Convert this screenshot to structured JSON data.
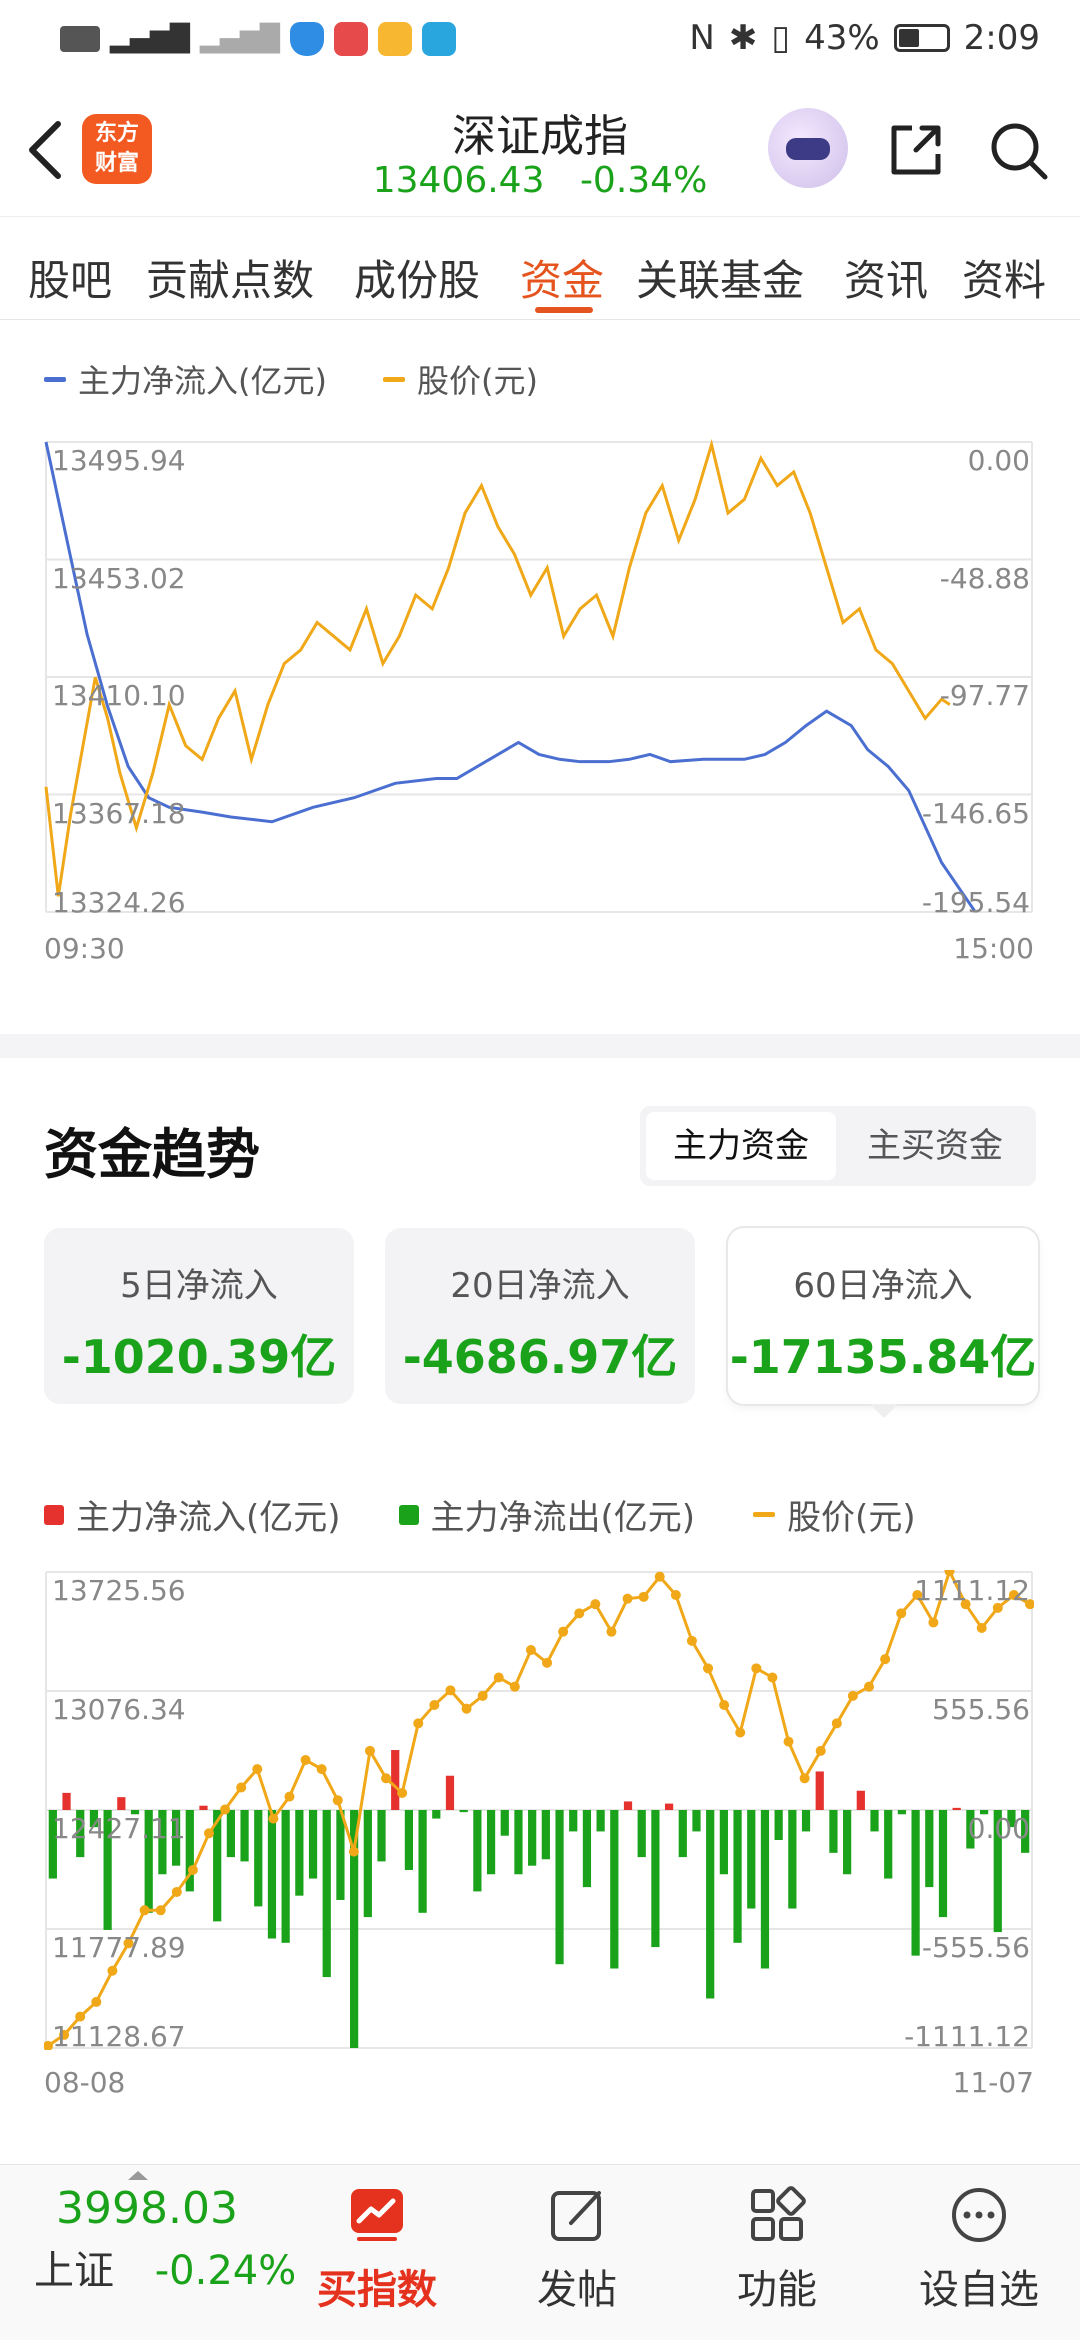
{
  "status_bar": {
    "left_icons": [
      "hd-icon",
      "sim-signal-icon",
      "no-signal-icon",
      "shield-app-icon",
      "huawei-app-icon",
      "folder-app-icon",
      "search-app-icon"
    ],
    "nfc": "N",
    "battery_percent": "43%",
    "time": "2:09"
  },
  "header": {
    "logo_line1": "东方",
    "logo_line2": "财富",
    "title": "深证成指",
    "price": "13406.43",
    "change_pct": "-0.34%"
  },
  "tabs": [
    {
      "label": "股吧"
    },
    {
      "label": "贡献点数"
    },
    {
      "label": "成份股"
    },
    {
      "label": "资金",
      "active": true
    },
    {
      "label": "关联基金"
    },
    {
      "label": "资讯"
    },
    {
      "label": "资料"
    }
  ],
  "intraday_legend": {
    "flow_label": "主力净流入(亿元)",
    "price_label": "股价(元)"
  },
  "colors": {
    "accent": "#e5541e",
    "up": "#e5322e",
    "down": "#1aa31a",
    "flow_line": "#4a6fd0",
    "price_line": "#f0a818"
  },
  "chart_data": [
    {
      "type": "line",
      "title": "",
      "x_labels": [
        "09:30",
        "15:00"
      ],
      "left_axis_ticks": [
        "13495.94",
        "13453.02",
        "13410.10",
        "13367.18",
        "13324.26"
      ],
      "right_axis_ticks": [
        "0.00",
        "-48.88",
        "-97.77",
        "-146.65",
        "-195.54"
      ],
      "left_ylim": [
        13324.26,
        13495.94
      ],
      "right_ylim": [
        -195.54,
        0.0
      ],
      "x_total_minutes": 240,
      "series": [
        {
          "name": "主力净流入(亿元)",
          "axis": "right",
          "x": [
            0,
            5,
            10,
            15,
            20,
            25,
            30,
            38,
            45,
            55,
            65,
            75,
            85,
            95,
            100,
            108,
            115,
            120,
            125,
            130,
            137,
            142,
            147,
            152,
            160,
            170,
            175,
            180,
            185,
            190,
            196,
            200,
            205,
            210,
            218,
            226
          ],
          "y": [
            0,
            -40,
            -80,
            -110,
            -135,
            -148,
            -152,
            -154,
            -156,
            -158,
            -152,
            -148,
            -142,
            -140,
            -140,
            -132,
            -125,
            -130,
            -132,
            -133,
            -133,
            -132,
            -130,
            -133,
            -132,
            -132,
            -130,
            -125,
            -118,
            -112,
            -118,
            -128,
            -135,
            -145,
            -175,
            -195
          ]
        },
        {
          "name": "股价(元)",
          "axis": "left",
          "x": [
            0,
            3,
            6,
            9,
            12,
            15,
            18,
            22,
            26,
            30,
            34,
            38,
            42,
            46,
            50,
            54,
            58,
            62,
            66,
            70,
            74,
            78,
            82,
            86,
            90,
            94,
            98,
            102,
            106,
            110,
            114,
            118,
            122,
            126,
            130,
            134,
            138,
            142,
            146,
            150,
            154,
            158,
            162,
            166,
            170,
            174,
            178,
            182,
            186,
            190,
            194,
            198,
            202,
            206,
            210,
            214,
            218,
            220
          ],
          "y": [
            13370,
            13330,
            13360,
            13385,
            13410,
            13395,
            13375,
            13355,
            13375,
            13400,
            13385,
            13380,
            13395,
            13405,
            13380,
            13400,
            13415,
            13420,
            13430,
            13425,
            13420,
            13435,
            13415,
            13425,
            13440,
            13435,
            13450,
            13470,
            13480,
            13465,
            13455,
            13440,
            13450,
            13425,
            13435,
            13440,
            13425,
            13450,
            13470,
            13480,
            13460,
            13475,
            13495,
            13470,
            13475,
            13490,
            13480,
            13485,
            13470,
            13450,
            13430,
            13435,
            13420,
            13415,
            13405,
            13395,
            13402,
            13400
          ]
        }
      ]
    },
    {
      "type": "bar",
      "title": "",
      "x_labels": [
        "08-08",
        "11-07"
      ],
      "left_axis_ticks": [
        "13725.56",
        "13076.34",
        "12427.11",
        "11777.89",
        "11128.67"
      ],
      "right_axis_ticks": [
        "1111.12",
        "555.56",
        "0.00",
        "-555.56",
        "-1111.12"
      ],
      "left_ylim": [
        11128.67,
        13725.56
      ],
      "right_ylim": [
        -1111.12,
        1111.12
      ],
      "series": [
        {
          "name": "主力净流入/净流出(亿元)",
          "axis": "right",
          "values": [
            -320,
            80,
            -220,
            -80,
            -560,
            60,
            -20,
            -480,
            -300,
            -260,
            -380,
            20,
            -520,
            -220,
            -240,
            -450,
            -600,
            -620,
            -400,
            -320,
            -780,
            -420,
            -1111,
            -500,
            -240,
            280,
            -280,
            -480,
            -40,
            160,
            -10,
            -380,
            -300,
            -120,
            -300,
            -260,
            -230,
            -720,
            -100,
            -360,
            -100,
            -740,
            40,
            -220,
            -640,
            30,
            -220,
            -100,
            -880,
            -300,
            -620,
            -460,
            -740,
            -140,
            -460,
            -100,
            180,
            -200,
            -300,
            90,
            -100,
            -320,
            -20,
            -680,
            -360,
            -500,
            10,
            -180,
            -20,
            -570,
            -80,
            -200
          ],
          "legend_positive": "主力净流入(亿元)",
          "legend_negative": "主力净流出(亿元)"
        },
        {
          "name": "股价(元)",
          "axis": "left",
          "values": [
            11140,
            11200,
            11300,
            11380,
            11550,
            11700,
            11880,
            11880,
            11980,
            12100,
            12300,
            12430,
            12550,
            12650,
            12380,
            12500,
            12700,
            12650,
            12480,
            12200,
            12750,
            12600,
            12520,
            12900,
            13000,
            13080,
            12980,
            13050,
            13150,
            13100,
            13300,
            13230,
            13400,
            13500,
            13550,
            13400,
            13580,
            13590,
            13700,
            13600,
            13350,
            13200,
            13000,
            12850,
            13200,
            13150,
            12800,
            12600,
            12750,
            12900,
            13050,
            13100,
            13250,
            13500,
            13600,
            13450,
            13730,
            13550,
            13420,
            13530,
            13600,
            13550
          ],
          "color_note": "orange line with dots"
        }
      ]
    }
  ],
  "section": {
    "title": "资金趋势",
    "toggle_selected": "主力资金",
    "toggle_other": "主买资金"
  },
  "cards": [
    {
      "label": "5日净流入",
      "value": "-1020.39亿"
    },
    {
      "label": "20日净流入",
      "value": "-4686.97亿"
    },
    {
      "label": "60日净流入",
      "value": "-17135.84亿",
      "selected": true
    }
  ],
  "trend_legend": {
    "inflow_label": "主力净流入(亿元)",
    "outflow_label": "主力净流出(亿元)",
    "price_label": "股价(元)"
  },
  "bottom_nav": {
    "ticker_price": "3998.03",
    "ticker_name": "上证",
    "ticker_pct": "-0.24%",
    "items": [
      {
        "label": "买指数",
        "icon": "trend-badge-icon"
      },
      {
        "label": "发帖",
        "icon": "edit-icon"
      },
      {
        "label": "功能",
        "icon": "grid-icon"
      },
      {
        "label": "设自选",
        "icon": "more-icon"
      }
    ]
  }
}
